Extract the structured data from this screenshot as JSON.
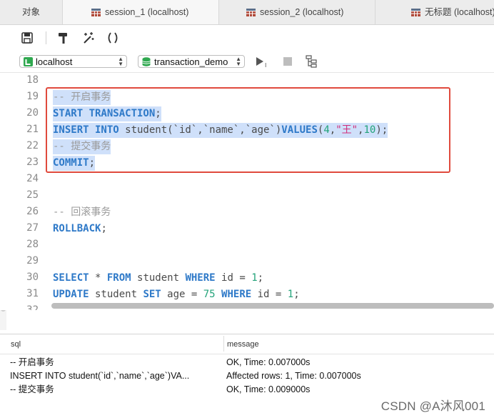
{
  "tabs": [
    {
      "label": "对象",
      "active": false,
      "icon": "none"
    },
    {
      "label": "session_1 (localhost)",
      "active": true,
      "icon": "table-grid-icon"
    },
    {
      "label": "session_2 (localhost)",
      "active": false,
      "icon": "table-grid-icon"
    },
    {
      "label": "无标题 (localhost)",
      "active": false,
      "icon": "table-grid-icon"
    }
  ],
  "toolbar": {
    "icons": [
      "save-icon",
      "format-hammer-icon",
      "beautify-wand-icon",
      "parentheses-icon"
    ]
  },
  "connection": {
    "label": "localhost",
    "icon": "connection-icon"
  },
  "database": {
    "label": "transaction_demo",
    "icon": "database-icon"
  },
  "run_controls": [
    "run-icon",
    "stop-icon",
    "explain-icon"
  ],
  "editor": {
    "line_numbers": [
      "18",
      "19",
      "20",
      "21",
      "22",
      "23",
      "24",
      "25",
      "26",
      "27",
      "28",
      "29",
      "30",
      "31",
      "32"
    ],
    "highlight_color": "#cfe0fa",
    "annotation_box_color": "#e04a3d"
  },
  "results": {
    "columns": [
      "sql",
      "message"
    ],
    "rows": [
      {
        "sql": "-- 开启事务",
        "message": "OK, Time: 0.007000s"
      },
      {
        "sql": "INSERT INTO student(`id`,`name`,`age`)VA...",
        "message": "Affected rows: 1, Time: 0.007000s"
      },
      {
        "sql": "-- 提交事务",
        "message": "OK, Time: 0.009000s"
      }
    ]
  },
  "watermark": "CSDN @A沐风001"
}
